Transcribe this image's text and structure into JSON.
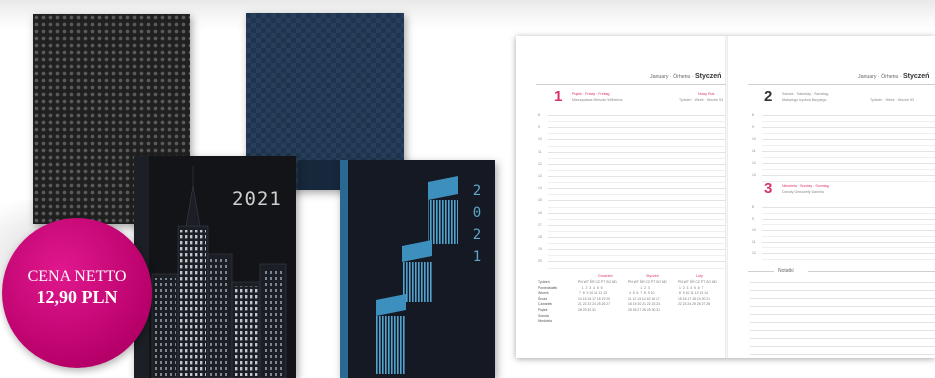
{
  "badge": {
    "line1": "CENA NETTO",
    "line2": "12,90 PLN",
    "color": "#c2007a"
  },
  "notebooks": {
    "city_year": "2021",
    "blue_year_partial": "202",
    "pattern_year_partial": "2021",
    "stair_year_digits": [
      "2",
      "0",
      "2",
      "1"
    ]
  },
  "planner": {
    "left_page": {
      "header_small": "January · Örhenu ·",
      "header_month": "Styczeń",
      "day_number": "1",
      "day_name": "Piątek · Friday · Freitag",
      "day_note": "Mieczysława Mieszko Wilhelma",
      "day_right": "Nowy Rok",
      "day_right_sub": "Tydzień · Week · Woche 53",
      "hours": [
        "8",
        "9",
        "10",
        "11",
        "12",
        "13",
        "14",
        "15",
        "16",
        "17",
        "18",
        "19",
        "20"
      ],
      "calendars": [
        {
          "title": "Grudzień",
          "rows": "PN WT ŚR CZ PT SO ND\n    1  2  3  4  5  6\n 7  8  9 10 11 12 13\n14 15 16 17 18 19 20\n21 22 23 24 25 26 27\n28 29 30 31"
        },
        {
          "title": "Styczeń",
          "rows": "PN WT ŚR CZ PT SO ND\n             1  2  3\n 4  5  6  7  8  9 10\n11 12 13 14 15 16 17\n18 19 20 21 22 23 24\n25 26 27 28 29 30 31"
        },
        {
          "title": "Luty",
          "rows": "PN WT ŚR CZ PT SO ND\n 1  2  3  4  5  6  7\n 8  9 10 11 12 13 14\n15 16 17 18 19 20 21\n22 23 24 25 26 27 28\n"
        }
      ],
      "week_labels": "Tydzień\nPoniedziałek\nWtorek\nŚroda\nCzwartek\nPiątek\nSobota\nNiedziela"
    },
    "right_page": {
      "header_small": "January · Örhenu ·",
      "header_month": "Styczeń",
      "day2_number": "2",
      "day2_name": "Sobota · Saturday · Samstag",
      "day2_note": "Makarego Izydora Bazylego",
      "day2_right": "Tydzień · Week · Woche 53",
      "day2_hours": [
        "8",
        "9",
        "10",
        "11",
        "12",
        "13"
      ],
      "day3_number": "3",
      "day3_name": "Niedziela · Sunday · Sonntag",
      "day3_note": "Danuty Genowefy Daniela",
      "day3_hours": [
        "8",
        "9",
        "10",
        "11",
        "12"
      ],
      "notes_label": "Notatki"
    }
  }
}
